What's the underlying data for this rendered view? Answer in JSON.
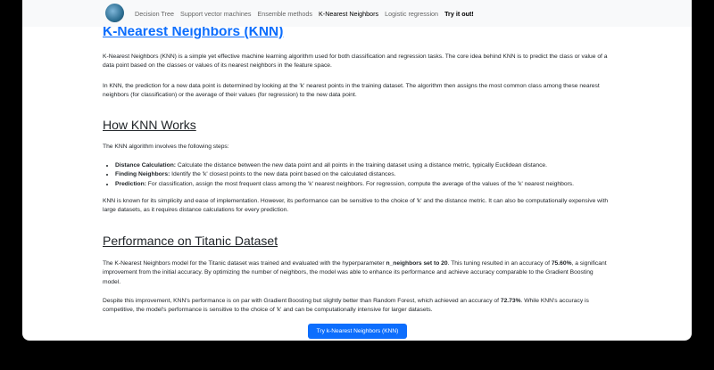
{
  "nav": {
    "items": [
      "Decision Tree",
      "Support vector machines",
      "Ensemble methods",
      "K-Nearest Neighbors",
      "Logistic regression",
      "Try it out!"
    ]
  },
  "main": {
    "title": "K-Nearest Neighbors (KNN)",
    "intro1": "K-Nearest Neighbors (KNN) is a simple yet effective machine learning algorithm used for both classification and regression tasks. The core idea behind KNN is to predict the class or value of a data point based on the classes or values of its nearest neighbors in the feature space.",
    "intro2": "In KNN, the prediction for a new data point is determined by looking at the 'k' nearest points in the training dataset. The algorithm then assigns the most common class among these nearest neighbors (for classification) or the average of their values (for regression) to the new data point.",
    "how_title": "How KNN Works",
    "how_intro": "The KNN algorithm involves the following steps:",
    "steps": [
      {
        "label": "Distance Calculation:",
        "text": " Calculate the distance between the new data point and all points in the training dataset using a distance metric, typically Euclidean distance."
      },
      {
        "label": "Finding Neighbors:",
        "text": " Identify the 'k' closest points to the new data point based on the calculated distances."
      },
      {
        "label": "Prediction:",
        "text": " For classification, assign the most frequent class among the 'k' nearest neighbors. For regression, compute the average of the values of the 'k' nearest neighbors."
      }
    ],
    "how_outro": "KNN is known for its simplicity and ease of implementation. However, its performance can be sensitive to the choice of 'k' and the distance metric. It can also be computationally expensive with large datasets, as it requires distance calculations for every prediction.",
    "perf_title": "Performance on Titanic Dataset",
    "perf1_a": "The K-Nearest Neighbors model for the Titanic dataset was trained and evaluated with the hyperparameter ",
    "perf1_b": "n_neighbors set to 20",
    "perf1_c": ". This tuning resulted in an accuracy of ",
    "perf1_d": "75.60%",
    "perf1_e": ", a significant improvement from the initial accuracy. By optimizing the number of neighbors, the model was able to enhance its performance and achieve accuracy comparable to the Gradient Boosting model.",
    "perf2_a": "Despite this improvement, KNN's performance is on par with Gradient Boosting but slightly better than Random Forest, which achieved an accuracy of ",
    "perf2_b": "72.73%",
    "perf2_c": ". While KNN's accuracy is competitive, the model's performance is sensitive to the choice of 'k' and can be computationally intensive for larger datasets.",
    "button": "Try k-Nearest Neighbors (KNN)"
  }
}
